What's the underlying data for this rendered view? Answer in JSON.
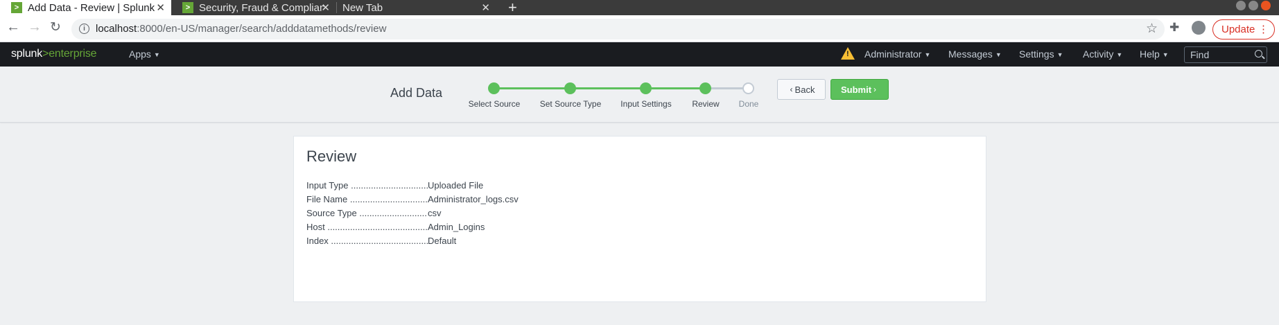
{
  "browser": {
    "tabs": [
      {
        "title": "Add Data - Review | Splunk",
        "favicon": "splunk-icon",
        "active": true
      },
      {
        "title": "Security, Fraud & Compliance",
        "favicon": "splunk-icon",
        "active": false
      },
      {
        "title": "New Tab",
        "active": false
      }
    ],
    "url_host": "localhost",
    "url_path": ":8000/en-US/manager/search/adddatamethods/review",
    "update_label": "Update"
  },
  "splunk": {
    "logo_left": "splunk",
    "logo_gt": ">",
    "logo_right": "enterprise",
    "apps_label": "Apps",
    "admin_label": "Administrator",
    "messages_label": "Messages",
    "settings_label": "Settings",
    "activity_label": "Activity",
    "help_label": "Help",
    "find_placeholder": "Find",
    "warning_icon": "warning-icon",
    "colors": {
      "brand_green": "#65a637",
      "nav_bg": "#1a1c20",
      "step_green": "#5cc05c",
      "warning": "#f8be34"
    }
  },
  "wizard": {
    "title": "Add Data",
    "steps": [
      {
        "label": "Select Source",
        "done": true
      },
      {
        "label": "Set Source Type",
        "done": true
      },
      {
        "label": "Input Settings",
        "done": true
      },
      {
        "label": "Review",
        "done": true
      },
      {
        "label": "Done",
        "done": false
      }
    ],
    "back_label": "Back",
    "submit_label": "Submit"
  },
  "review": {
    "title": "Review",
    "items": [
      {
        "label": "Input Type",
        "value": "Uploaded File"
      },
      {
        "label": "File Name",
        "value": "Administrator_logs.csv"
      },
      {
        "label": "Source Type",
        "value": "csv"
      },
      {
        "label": "Host",
        "value": "Admin_Logins"
      },
      {
        "label": "Index",
        "value": "Default"
      }
    ]
  }
}
